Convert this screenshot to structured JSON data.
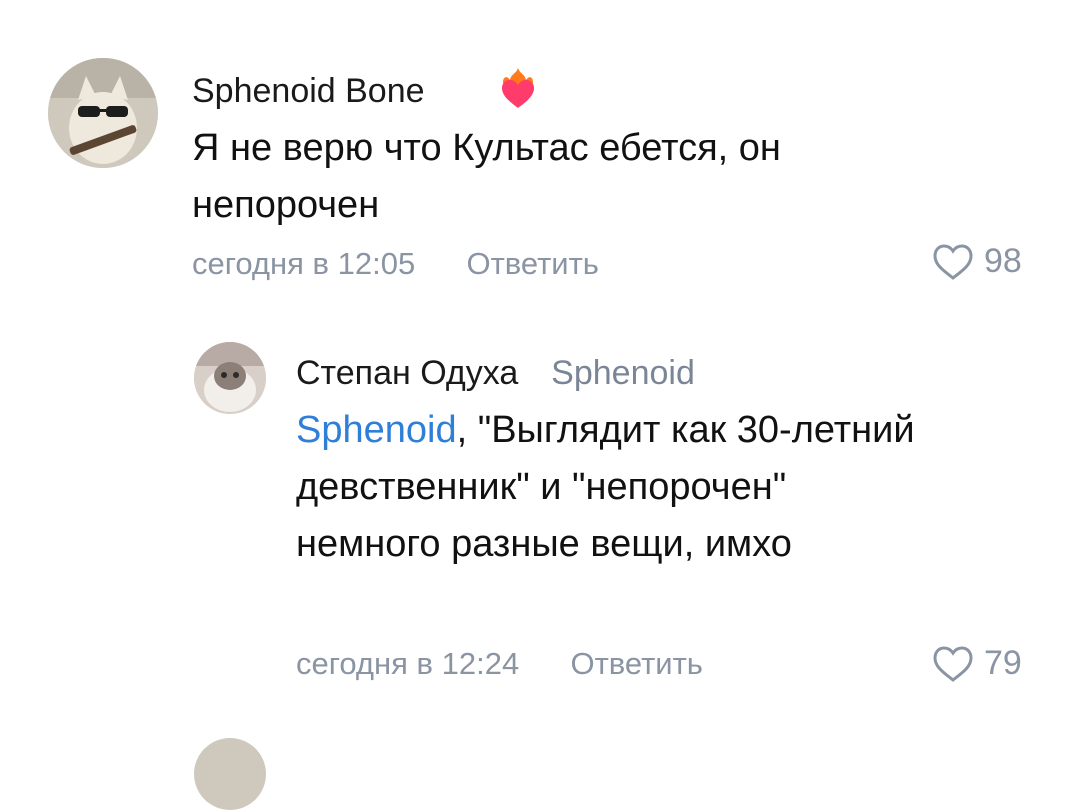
{
  "comments": [
    {
      "author": "Sphenoid Bone",
      "badge_icon": "flaming-heart-icon",
      "text": "Я не верю что Культас ебется, он непорочен",
      "time": "сегодня в 12:05",
      "reply_label": "Ответить",
      "likes": "98"
    }
  ],
  "replies": [
    {
      "author": "Степан Одуха",
      "reply_to": "Sphenoid",
      "mention": "Sphenoid",
      "text": ", \"Выглядит как 30-летний девственник\" и \"непорочен\" немного разные вещи, имхо",
      "time": "сегодня в 12:24",
      "reply_label": "Ответить",
      "likes": "79"
    }
  ],
  "colors": {
    "mention": "#2f7fd8",
    "meta": "#8a94a3",
    "badge_heart": "#ff3b6b",
    "badge_flame": "#ff7a1a"
  }
}
